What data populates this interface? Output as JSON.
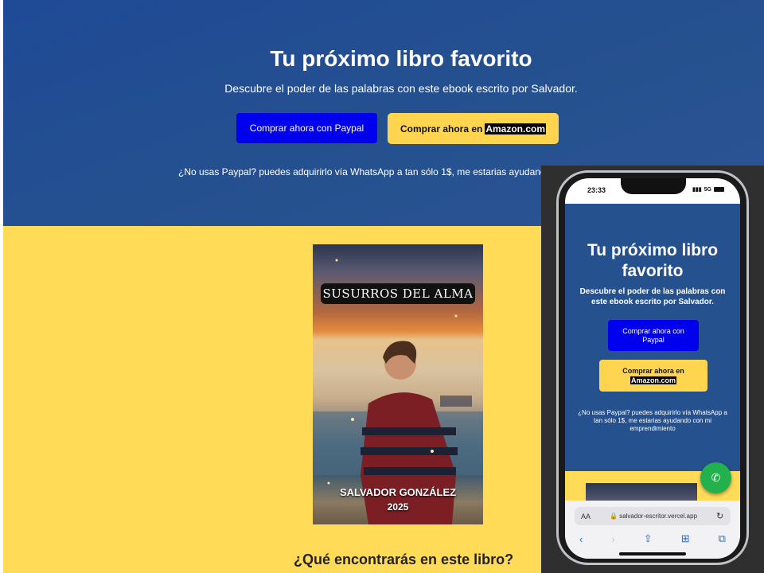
{
  "desktop": {
    "hero": {
      "title": "Tu próximo libro favorito",
      "subtitle": "Descubre el poder de las palabras con este ebook escrito por Salvador.",
      "paypal_button": "Comprar ahora con Paypal",
      "amazon_prefix": "Comprar ahora en",
      "amazon_link": "Amazon.com",
      "note": "¿No usas Paypal? puedes adquirirlo vía WhatsApp a tan sólo 1$, me estarias ayudando con"
    },
    "book_cover": {
      "title": "SUSURROS DEL ALMA",
      "author": "SALVADOR GONZÁLEZ",
      "year": "2025"
    },
    "section_title": "¿Qué encontrarás en este libro?"
  },
  "mobile": {
    "status": {
      "time": "23:33",
      "network": "5G"
    },
    "title": "Tu próximo libro favorito",
    "subtitle": "Descubre el poder de las palabras con este ebook escrito por Salvador.",
    "paypal_button": "Comprar ahora con Paypal",
    "amazon_prefix": "Comprar ahora en",
    "amazon_link": "Amazon.com",
    "note": "¿No usas Paypal? puedes adquirirlo vía WhatsApp a tan sólo 1$, me estarias ayudando con mi emprendimiento",
    "browser": {
      "aa_label": "AA",
      "url": "salvador-escritor.vercel.app"
    },
    "icons": [
      "whatsapp-icon",
      "lock-icon",
      "reload-icon",
      "back-icon",
      "forward-icon",
      "share-icon",
      "bookmarks-icon",
      "tabs-icon"
    ]
  },
  "colors": {
    "hero_blue": "#26518f",
    "paypal_blue": "#0000ee",
    "amazon_yellow": "#ffd54f",
    "section_yellow": "#ffdb58",
    "whatsapp_green": "#22b14c"
  }
}
